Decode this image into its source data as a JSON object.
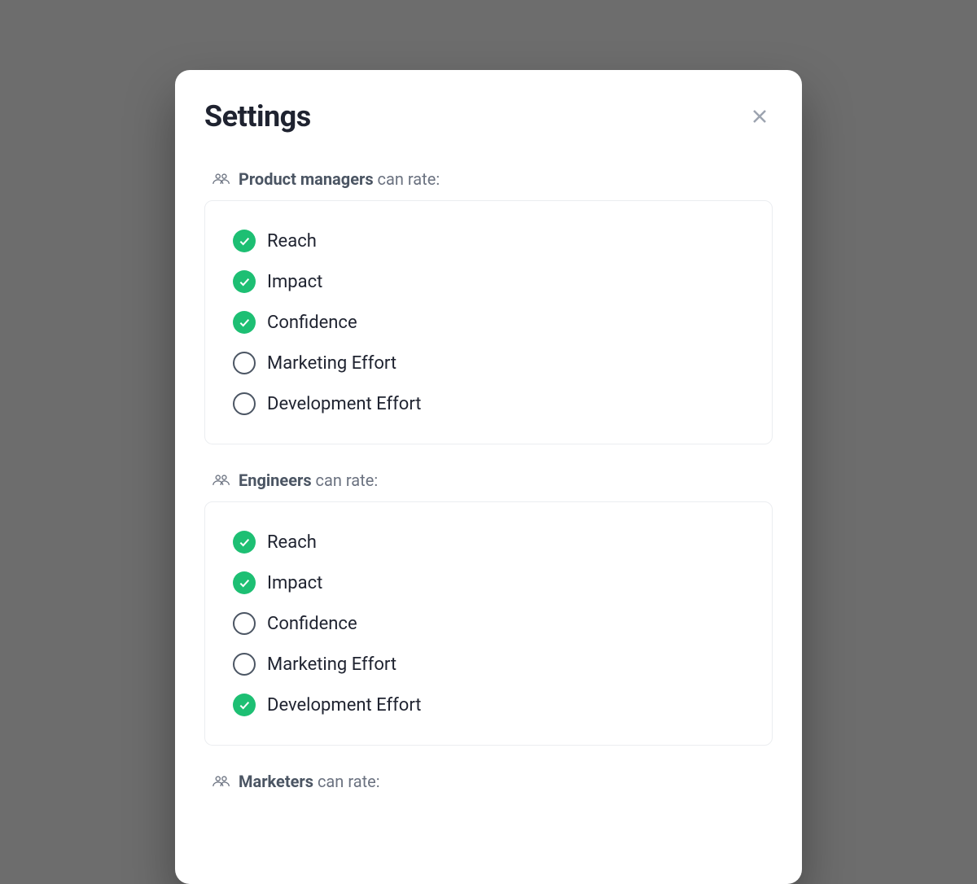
{
  "modal": {
    "title": "Settings",
    "label_suffix": " can rate:",
    "sections": [
      {
        "role": "Product managers",
        "options": [
          {
            "label": "Reach",
            "checked": true
          },
          {
            "label": "Impact",
            "checked": true
          },
          {
            "label": "Confidence",
            "checked": true
          },
          {
            "label": "Marketing Effort",
            "checked": false
          },
          {
            "label": "Development Effort",
            "checked": false
          }
        ]
      },
      {
        "role": "Engineers",
        "options": [
          {
            "label": "Reach",
            "checked": true
          },
          {
            "label": "Impact",
            "checked": true
          },
          {
            "label": "Confidence",
            "checked": false
          },
          {
            "label": "Marketing Effort",
            "checked": false
          },
          {
            "label": "Development Effort",
            "checked": true
          }
        ]
      },
      {
        "role": "Marketers",
        "options": []
      }
    ]
  }
}
